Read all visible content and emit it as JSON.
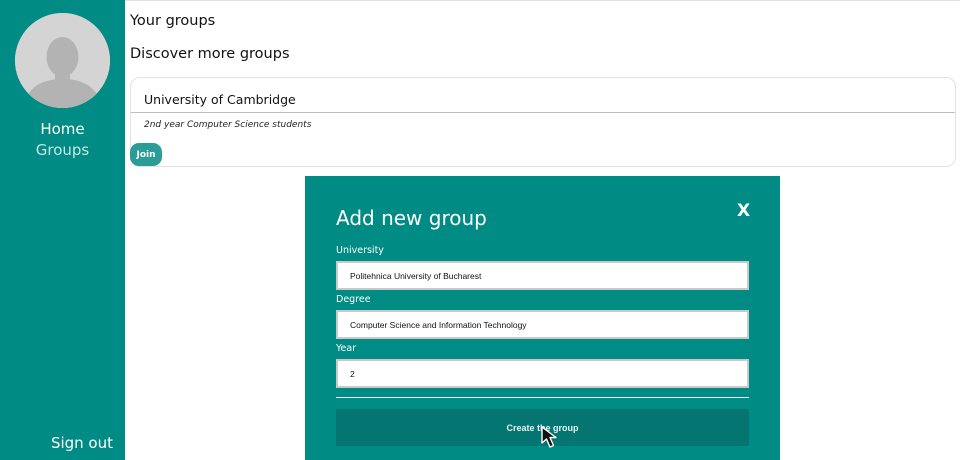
{
  "sidebar": {
    "nav": {
      "home": "Home",
      "groups": "Groups",
      "sign_out": "Sign out"
    },
    "avatar_icon": "default-user-silhouette"
  },
  "main": {
    "your_groups_heading": "Your groups",
    "discover_heading": "Discover more groups",
    "groups": [
      {
        "name": "University of Cambridge",
        "description": "2nd year Computer Science students",
        "join_label": "Join"
      }
    ]
  },
  "modal": {
    "title": "Add new group",
    "close_label": "X",
    "fields": {
      "university": {
        "label": "University",
        "value": "Politehnica University of Bucharest"
      },
      "degree": {
        "label": "Degree",
        "value": "Computer Science and Information Technology"
      },
      "year": {
        "label": "Year",
        "value": "2"
      }
    },
    "submit_label": "Create the group"
  },
  "colors": {
    "primary": "#008b84",
    "primary_dark": "#057572",
    "join_button": "#2a9d97",
    "avatar_bg": "#d4d4d4"
  }
}
